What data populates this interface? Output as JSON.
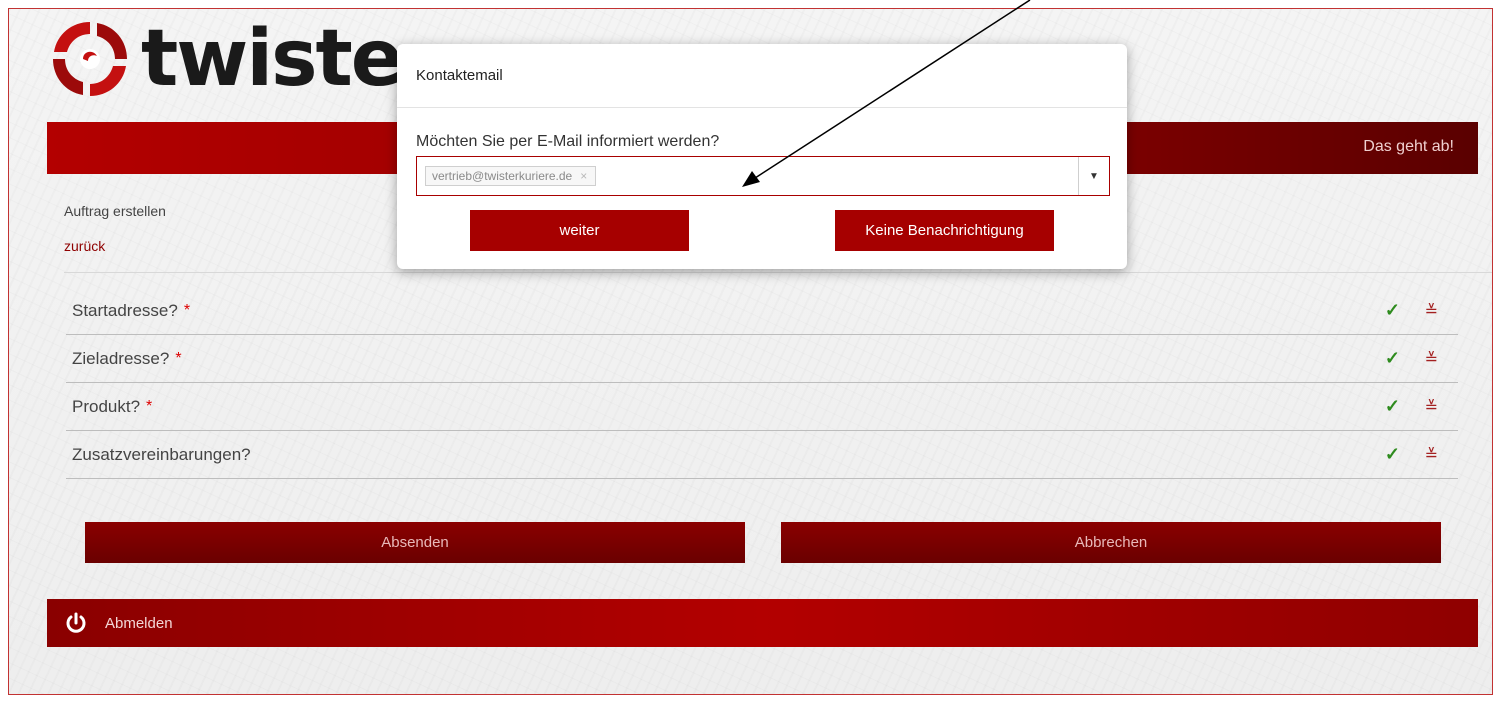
{
  "header": {
    "logo_text": "twiste",
    "tagline": "Das geht ab!"
  },
  "page": {
    "breadcrumb": "Auftrag erstellen",
    "back_link": "zurück"
  },
  "sections": [
    {
      "label": "Startadresse?",
      "required": "*",
      "status": "✓",
      "toggle": "≚"
    },
    {
      "label": "Zieladresse?",
      "required": "*",
      "status": "✓",
      "toggle": "≚"
    },
    {
      "label": "Produkt?",
      "required": "*",
      "status": "✓",
      "toggle": "≚"
    },
    {
      "label": "Zusatzvereinbarungen?",
      "required": "",
      "status": "✓",
      "toggle": "≚"
    }
  ],
  "actions": {
    "submit_label": "Absenden",
    "cancel_label": "Abbrechen"
  },
  "footer": {
    "logout_label": "Abmelden"
  },
  "modal": {
    "title": "Kontaktemail",
    "question": "Möchten Sie per E-Mail informiert werden?",
    "selected_email": "vertrieb@twisterkuriere.de",
    "remove_glyph": "×",
    "dropdown_caret": "▼",
    "continue_label": "weiter",
    "no_notification_label": "Keine Benachrichtigung"
  },
  "colors": {
    "brand_red": "#a60000",
    "dark_red": "#6a0000",
    "check_green": "#2e8b1e"
  },
  "icons": [
    "logo-swirl-icon",
    "check-icon",
    "chevron-double-down-icon",
    "power-icon",
    "remove-tag-icon",
    "dropdown-caret-icon"
  ]
}
